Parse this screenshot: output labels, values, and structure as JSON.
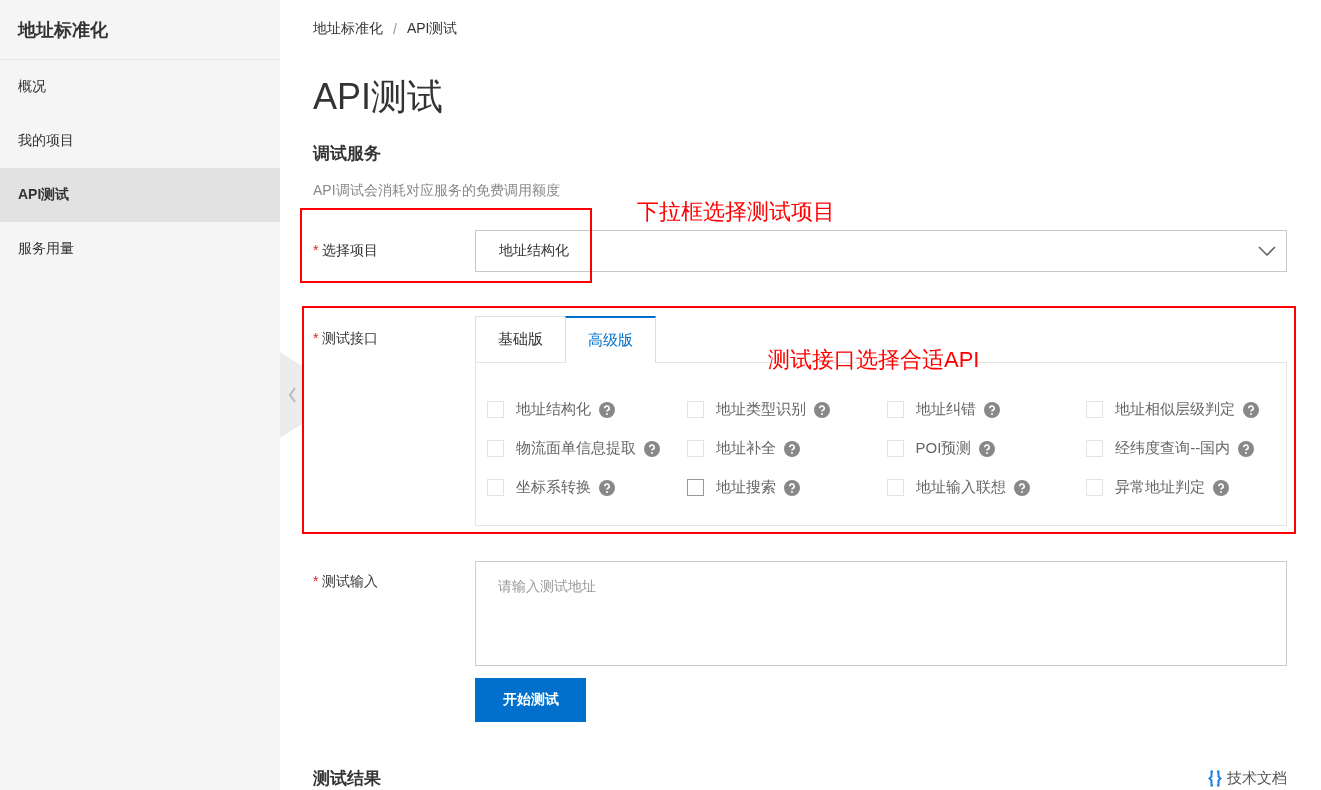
{
  "sidebar": {
    "title": "地址标准化",
    "items": [
      {
        "label": "概况",
        "selected": false
      },
      {
        "label": "我的项目",
        "selected": false
      },
      {
        "label": "API测试",
        "selected": true
      },
      {
        "label": "服务用量",
        "selected": false
      }
    ]
  },
  "breadcrumb": [
    "地址标准化",
    "API测试"
  ],
  "breadcrumb_separator": "/",
  "page_title": "API测试",
  "section": {
    "title": "调试服务",
    "description": "API调试会消耗对应服务的免费调用额度"
  },
  "form": {
    "project": {
      "label": "选择项目",
      "required": true,
      "value": "地址结构化"
    },
    "interface": {
      "label": "测试接口",
      "required": true,
      "tabs": [
        {
          "label": "基础版",
          "selected": false
        },
        {
          "label": "高级版",
          "selected": true
        }
      ],
      "options": [
        {
          "label": "地址结构化",
          "checked": false,
          "disabled": true
        },
        {
          "label": "地址类型识别",
          "checked": false,
          "disabled": true
        },
        {
          "label": "地址纠错",
          "checked": false,
          "disabled": true
        },
        {
          "label": "地址相似层级判定",
          "checked": false,
          "disabled": true
        },
        {
          "label": "物流面单信息提取",
          "checked": false,
          "disabled": true
        },
        {
          "label": "地址补全",
          "checked": false,
          "disabled": true
        },
        {
          "label": "POI预测",
          "checked": false,
          "disabled": true
        },
        {
          "label": "经纬度查询--国内",
          "checked": false,
          "disabled": true
        },
        {
          "label": "坐标系转换",
          "checked": false,
          "disabled": true
        },
        {
          "label": "地址搜索",
          "checked": false,
          "disabled": false
        },
        {
          "label": "地址输入联想",
          "checked": false,
          "disabled": true
        },
        {
          "label": "异常地址判定",
          "checked": false,
          "disabled": true
        }
      ]
    },
    "input": {
      "label": "测试输入",
      "required": true,
      "placeholder": "请输入测试地址"
    },
    "submit": "开始测试"
  },
  "result": {
    "title": "测试结果",
    "doc_link": "技术文档"
  },
  "annotations": [
    {
      "kind": "box"
    },
    {
      "kind": "text",
      "text": "下拉框选择测试项目"
    },
    {
      "kind": "box"
    },
    {
      "kind": "text",
      "text": "测试接口选择合适API"
    }
  ],
  "required_mark": "*"
}
